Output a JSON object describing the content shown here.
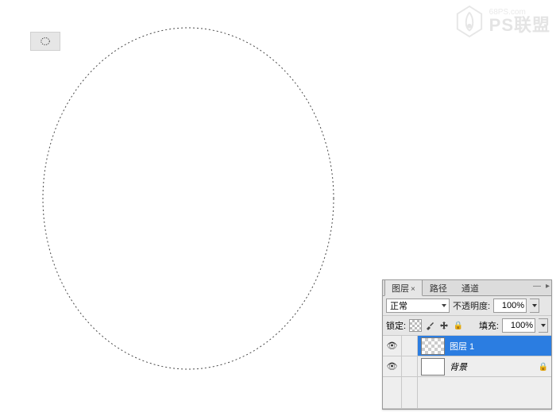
{
  "watermark": {
    "url": "68PS.com",
    "brand": "PS联盟"
  },
  "tool": {
    "name": "elliptical-marquee"
  },
  "panel": {
    "tabs": {
      "layers": "图层",
      "paths": "路径",
      "channels": "通道"
    },
    "blend_mode_label": "正常",
    "opacity_label": "不透明度:",
    "opacity_value": "100%",
    "lock_label": "锁定:",
    "fill_label": "填充:",
    "fill_value": "100%",
    "layers": [
      {
        "name": "图层 1",
        "visible": true,
        "selected": true,
        "locked": false,
        "transparent": true
      },
      {
        "name": "背景",
        "visible": true,
        "selected": false,
        "locked": true,
        "transparent": false
      }
    ]
  }
}
